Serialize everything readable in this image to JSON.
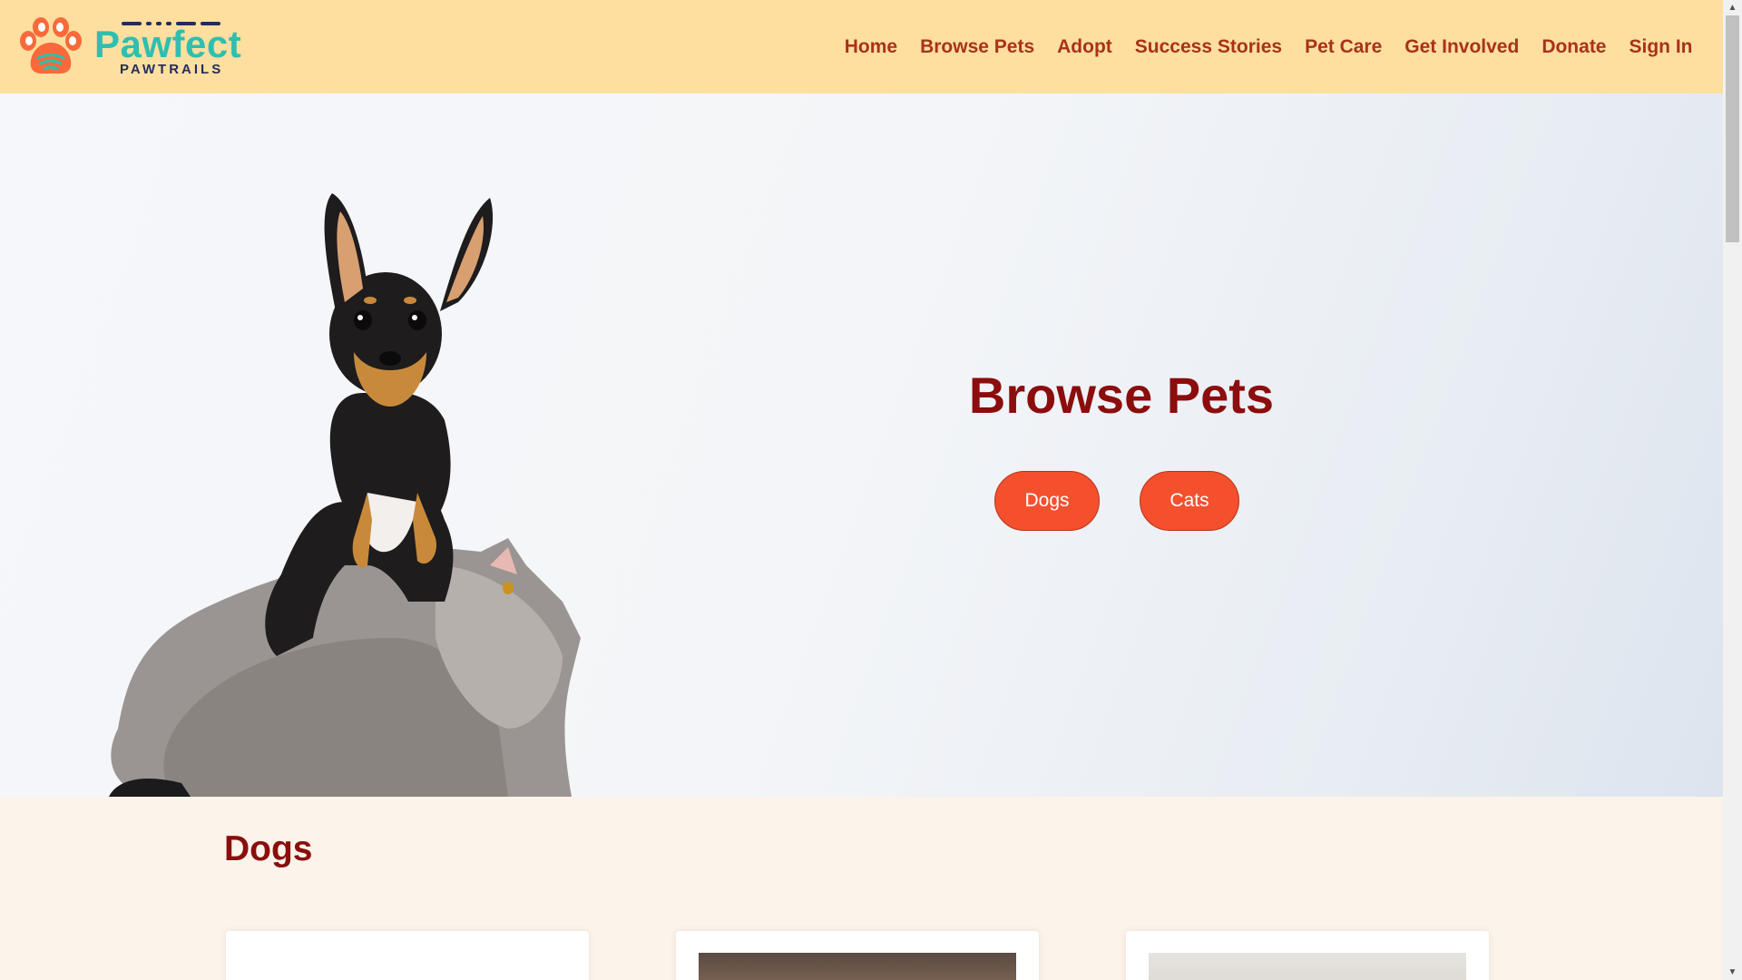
{
  "header": {
    "brand_name": "Pawfect",
    "brand_sub": "PAWTRAILS",
    "nav": [
      "Home",
      "Browse Pets",
      "Adopt",
      "Success Stories",
      "Pet Care",
      "Get Involved",
      "Donate",
      "Sign In"
    ]
  },
  "hero": {
    "title": "Browse Pets",
    "buttons": {
      "dogs": "Dogs",
      "cats": "Cats"
    }
  },
  "dogs_section": {
    "title": "Dogs"
  },
  "colors": {
    "header_bg": "#ffdfa0",
    "nav_text": "#a8321a",
    "title_text": "#8b0d0d",
    "button_bg": "#f4502e",
    "brand_teal": "#2fbfb0",
    "brand_navy": "#232d5c",
    "paw_orange": "#f86a3a",
    "section_bg": "#fcf3ea"
  },
  "icons": {
    "logo": "paw-logo-icon",
    "scroll_up": "chevron-up-icon",
    "scroll_down": "chevron-down-icon"
  }
}
